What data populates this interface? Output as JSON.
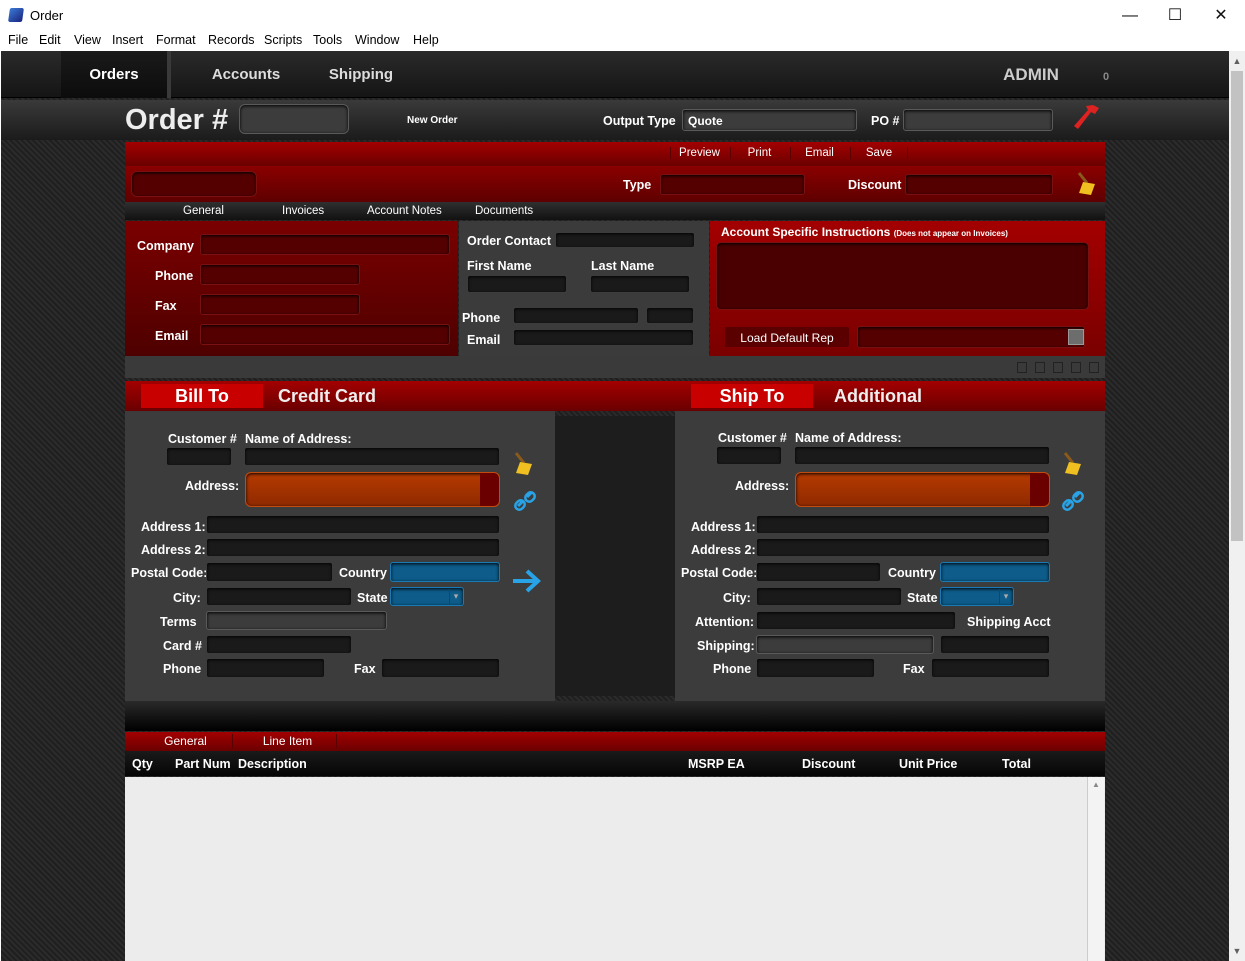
{
  "window": {
    "title": "Order",
    "minimize": "—",
    "maximize": "☐",
    "close": "✕"
  },
  "menu": [
    "File",
    "Edit",
    "View",
    "Insert",
    "Format",
    "Records",
    "Scripts",
    "Tools",
    "Window",
    "Help"
  ],
  "nav": {
    "tabs": [
      "Orders",
      "Accounts",
      "Shipping"
    ],
    "user": "ADMIN",
    "count": "0"
  },
  "header": {
    "order_label": "Order #",
    "new_order": "New Order",
    "output_type_label": "Output Type",
    "output_type_value": "Quote",
    "po_label": "PO #"
  },
  "actions": [
    "Preview",
    "Print",
    "Email",
    "Save"
  ],
  "summary": {
    "type_label": "Type",
    "discount_label": "Discount"
  },
  "tabs1": [
    "General",
    "Invoices",
    "Account Notes",
    "Documents"
  ],
  "company": {
    "company": "Company",
    "phone": "Phone",
    "fax": "Fax",
    "email": "Email"
  },
  "contact": {
    "order_contact": "Order Contact",
    "first_name": "First Name",
    "last_name": "Last Name",
    "phone": "Phone",
    "email": "Email"
  },
  "instructions": {
    "title": "Account Specific Instructions",
    "note": "(Does not appear on Invoices)",
    "load_rep": "Load Default Rep"
  },
  "bill": {
    "tab_active": "Bill To",
    "tab_other": "Credit Card",
    "customer_no": "Customer #",
    "name_of_address": "Name of Address:",
    "address": "Address:",
    "address1": "Address 1:",
    "address2": "Address 2:",
    "postal": "Postal Code:",
    "country": "Country",
    "city": "City:",
    "state": "State",
    "terms": "Terms",
    "card": "Card #",
    "phone": "Phone",
    "fax": "Fax"
  },
  "ship": {
    "tab_active": "Ship To",
    "tab_other": "Additional",
    "customer_no": "Customer #",
    "name_of_address": "Name of Address:",
    "address": "Address:",
    "address1": "Address 1:",
    "address2": "Address 2:",
    "postal": "Postal Code:",
    "country": "Country",
    "city": "City:",
    "state": "State",
    "attention": "Attention:",
    "shipping_acct": "Shipping Acct",
    "shipping": "Shipping:",
    "phone": "Phone",
    "fax": "Fax"
  },
  "lines": {
    "tabs": [
      "General",
      "Line Item"
    ],
    "columns": [
      "Qty",
      "Part Num",
      "Description",
      "MSRP EA",
      "Discount",
      "Unit Price",
      "Total"
    ]
  },
  "colors": {
    "accent_red": "#a30000",
    "field_blue": "#0e5c8a",
    "address_orange": "#b63a00"
  }
}
